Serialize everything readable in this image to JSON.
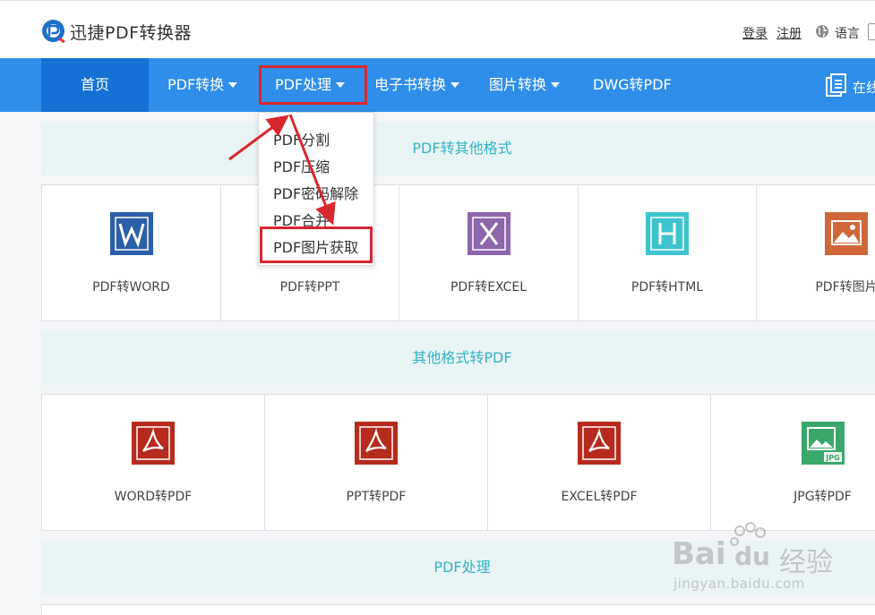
{
  "header": {
    "brand": "迅捷PDF转换器",
    "login": "登录",
    "register": "注册",
    "language": "语言"
  },
  "nav": {
    "items": [
      {
        "label": "首页"
      },
      {
        "label": "PDF转换"
      },
      {
        "label": "PDF处理"
      },
      {
        "label": "电子书转换"
      },
      {
        "label": "图片转换"
      },
      {
        "label": "DWG转PDF"
      }
    ],
    "online": "在线"
  },
  "dropdown": {
    "items": [
      "PDF分割",
      "PDF压缩",
      "PDF密码解除",
      "PDF合并",
      "PDF图片获取"
    ]
  },
  "sections": {
    "pdf_to_other": {
      "title": "PDF转其他格式",
      "cards": [
        {
          "label": "PDF转WORD",
          "icon": "word-icon",
          "color": "#2b5fa9"
        },
        {
          "label": "PDF转PPT",
          "icon": "ppt-icon",
          "color": "#d04424"
        },
        {
          "label": "PDF转EXCEL",
          "icon": "excel-icon",
          "color": "#8d66ab"
        },
        {
          "label": "PDF转HTML",
          "icon": "html-icon",
          "color": "#3ec4cf"
        },
        {
          "label": "PDF转图片",
          "icon": "image-icon",
          "color": "#d0673a"
        }
      ]
    },
    "other_to_pdf": {
      "title": "其他格式转PDF",
      "cards": [
        {
          "label": "WORD转PDF",
          "icon": "pdf-icon",
          "color": "#b72a1e"
        },
        {
          "label": "PPT转PDF",
          "icon": "pdf-icon",
          "color": "#b72a1e"
        },
        {
          "label": "EXCEL转PDF",
          "icon": "pdf-icon",
          "color": "#b72a1e"
        },
        {
          "label": "JPG转PDF",
          "icon": "jpg-icon",
          "color": "#3aa86a"
        }
      ]
    },
    "pdf_process": {
      "title": "PDF处理"
    }
  },
  "watermark": {
    "brand": "Bai",
    "suffix": "du",
    "text": "经验",
    "url": "jingyan.baidu.com"
  },
  "colors": {
    "nav_bg": "#2f8ee9",
    "nav_active": "#1571d3",
    "section_text": "#36b3c5",
    "annotation": "#d9272e"
  }
}
